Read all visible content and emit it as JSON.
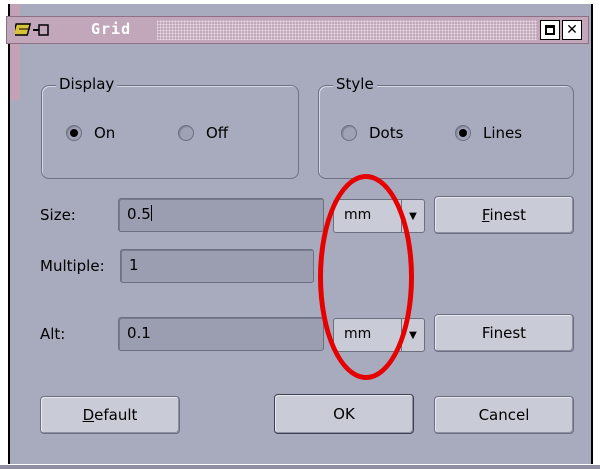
{
  "window": {
    "title": "Grid",
    "icons": [
      "grid-app-icon",
      "pin-icon"
    ],
    "controls": [
      "maximize",
      "close"
    ]
  },
  "display": {
    "label": "Display",
    "options": [
      {
        "label": "On",
        "selected": true
      },
      {
        "label": "Off",
        "selected": false
      }
    ]
  },
  "style": {
    "label": "Style",
    "options": [
      {
        "label": "Dots",
        "selected": false
      },
      {
        "label": "Lines",
        "selected": true
      }
    ]
  },
  "size": {
    "label": "Size:",
    "value": "0.5",
    "unit": "mm",
    "button": "Finest"
  },
  "multiple": {
    "label": "Multiple:",
    "value": "1"
  },
  "alt": {
    "label": "Alt:",
    "value": "0.1",
    "unit": "mm",
    "button": "Finest"
  },
  "buttons": {
    "default": "Default",
    "ok": "OK",
    "cancel": "Cancel"
  },
  "annotation": {
    "color": "#e60000",
    "shape": "ellipse"
  }
}
